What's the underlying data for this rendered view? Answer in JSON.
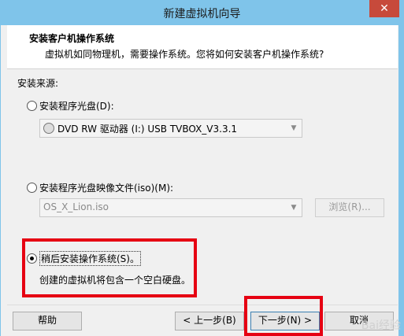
{
  "window": {
    "title": "新建虚拟机向导",
    "close_glyph": "✕"
  },
  "header": {
    "title": "安装客户机操作系统",
    "subtitle": "虚拟机如同物理机，需要操作系统。您将如何安装客户机操作系统?"
  },
  "source": {
    "label": "安装来源:"
  },
  "options": {
    "disc": {
      "label": "安装程序光盘(D):",
      "selected": false,
      "drive": "DVD RW 驱动器 (I:) USB TVBOX_V3.3.1"
    },
    "iso": {
      "label": "安装程序光盘映像文件(iso)(M):",
      "selected": false,
      "value": "OS_X_Lion.iso",
      "browse_label": "浏览(R)..."
    },
    "later": {
      "label": "稍后安装操作系统(S)。",
      "selected": true,
      "desc": "创建的虚拟机将包含一个空白硬盘。"
    }
  },
  "buttons": {
    "help": "帮助",
    "back": "< 上一步(B)",
    "next": "下一步(N) >",
    "cancel": "取消"
  },
  "watermark": "Bai经验",
  "colors": {
    "titlebar": "#7fc4ea",
    "highlight": "#e60012",
    "close": "#c74a3b"
  },
  "icons": {
    "disc": "disc-icon",
    "dropdown": "chevron-down-icon",
    "close": "close-icon"
  }
}
